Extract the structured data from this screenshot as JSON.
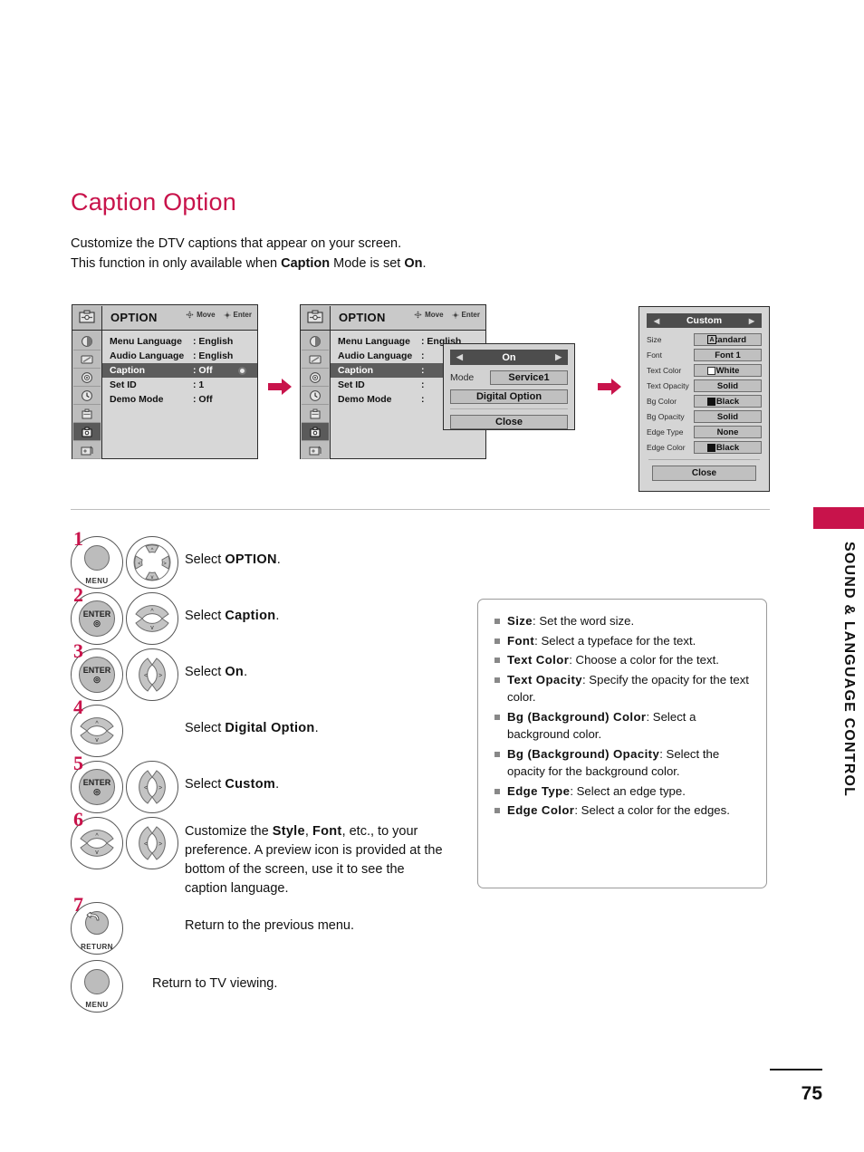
{
  "page": {
    "title": "Caption Option",
    "intro_line1": "Customize the DTV captions that appear on your screen.",
    "intro_line2_a": "This function in only available when ",
    "intro_line2_b": "Caption",
    "intro_line2_c": " Mode is set ",
    "intro_line2_d": "On",
    "intro_line2_e": ".",
    "side_label": "SOUND & LANGUAGE CONTROL",
    "page_number": "75",
    "accent_color": "#c8134b"
  },
  "osd1": {
    "title": "OPTION",
    "hint_move": "Move",
    "hint_enter": "Enter",
    "rows": [
      {
        "label": "Menu Language",
        "value": ": English",
        "selected": false,
        "dot": false
      },
      {
        "label": "Audio Language",
        "value": ": English",
        "selected": false,
        "dot": false
      },
      {
        "label": "Caption",
        "value": ": Off",
        "selected": true,
        "dot": true
      },
      {
        "label": "Set ID",
        "value": ": 1",
        "selected": false,
        "dot": false
      },
      {
        "label": "Demo Mode",
        "value": ": Off",
        "selected": false,
        "dot": false
      }
    ],
    "rail_icons": [
      "picture-icon",
      "screen-icon",
      "audio-icon",
      "time-icon",
      "lock-icon",
      "option-icon",
      "usb-icon"
    ],
    "rail_selected_index": 5
  },
  "osd2": {
    "title": "OPTION",
    "hint_move": "Move",
    "hint_enter": "Enter",
    "rows": [
      {
        "label": "Menu Language",
        "value": ": English",
        "selected": false
      },
      {
        "label": "Audio Language",
        "value": ": ",
        "selected": false
      },
      {
        "label": "Caption",
        "value": ": ",
        "selected": true
      },
      {
        "label": "Set ID",
        "value": ": ",
        "selected": false
      },
      {
        "label": "Demo Mode",
        "value": ": ",
        "selected": false
      }
    ],
    "popup": {
      "title": "On",
      "arrow_left": "◀",
      "arrow_right": "▶",
      "mode_label": "Mode",
      "mode_value": "Service1",
      "digital_option": "Digital Option",
      "close": "Close"
    }
  },
  "custom_panel": {
    "title": "Custom",
    "arrow_left": "◀",
    "arrow_right": "▶",
    "rows": [
      {
        "label": "Size",
        "value": "Standard",
        "swatch": "letterA"
      },
      {
        "label": "Font",
        "value": "Font 1",
        "swatch": "none"
      },
      {
        "label": "Text Color",
        "value": "White",
        "swatch": "white"
      },
      {
        "label": "Text Opacity",
        "value": "Solid",
        "swatch": "none"
      },
      {
        "label": "Bg Color",
        "value": "Black",
        "swatch": "black"
      },
      {
        "label": "Bg Opacity",
        "value": "Solid",
        "swatch": "none"
      },
      {
        "label": "Edge Type",
        "value": "None",
        "swatch": "none"
      },
      {
        "label": "Edge Color",
        "value": "Black",
        "swatch": "black"
      }
    ],
    "close": "Close"
  },
  "steps": [
    {
      "num": "1",
      "keys": [
        "menu-button",
        "navigation-wheel"
      ],
      "text_pre": "Select ",
      "text_bold": "OPTION",
      "text_post": "."
    },
    {
      "num": "2",
      "keys": [
        "enter-button",
        "up-down-button"
      ],
      "text_pre": "Select ",
      "text_bold": "Caption",
      "text_post": "."
    },
    {
      "num": "3",
      "keys": [
        "enter-button",
        "left-right-button"
      ],
      "text_pre": "Select ",
      "text_bold": "On",
      "text_post": "."
    },
    {
      "num": "4",
      "keys": [
        "up-down-button"
      ],
      "text_pre": "Select ",
      "text_bold": "Digital Option",
      "text_post": "."
    },
    {
      "num": "5",
      "keys": [
        "enter-button",
        "left-right-button"
      ],
      "text_pre": "Select ",
      "text_bold": "Custom",
      "text_post": "."
    },
    {
      "num": "6",
      "keys": [
        "up-down-button",
        "left-right-button"
      ],
      "text_pre": "Customize the ",
      "text_bold": "Style",
      "text_bold2": "Font",
      "text_post": ", etc., to your preference. A preview icon is provided at the bottom of the screen, use it to see the caption language."
    },
    {
      "num": "7",
      "keys": [
        "return-button"
      ],
      "text_pre": "Return to the previous menu.",
      "text_bold": "",
      "text_post": ""
    },
    {
      "num": "",
      "keys": [
        "menu-button"
      ],
      "text_pre": "Return to TV viewing.",
      "text_bold": "",
      "text_post": ""
    }
  ],
  "key_labels": {
    "menu": "MENU",
    "enter": "ENTER",
    "return": "RETURN"
  },
  "notes": [
    {
      "term": "Size",
      "desc": ": Set the word size."
    },
    {
      "term": "Font",
      "desc": ": Select a typeface for the text."
    },
    {
      "term": "Text Color",
      "desc": ": Choose a color for the text."
    },
    {
      "term": "Text Opacity",
      "desc": ": Specify the opacity for the text color."
    },
    {
      "term": "Bg (Background) Color",
      "desc": ": Select a background color."
    },
    {
      "term": "Bg (Background) Opacity",
      "desc": ": Select the opacity for the background color."
    },
    {
      "term": "Edge Type",
      "desc": ": Select an edge type."
    },
    {
      "term": "Edge Color",
      "desc": ": Select a color for the edges."
    }
  ]
}
